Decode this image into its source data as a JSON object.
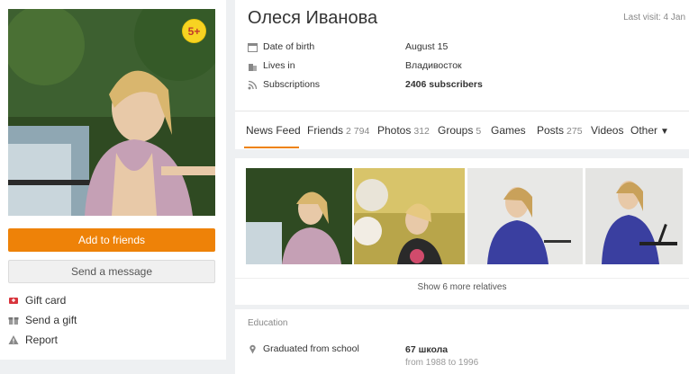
{
  "profile": {
    "name": "Олеся Иванова",
    "last_visit": "Last visit: 4 Jan",
    "age_badge": "5+"
  },
  "actions": {
    "add_friends": "Add to friends",
    "send_message": "Send a message",
    "gift_card": "Gift card",
    "send_gift": "Send a gift",
    "report": "Report"
  },
  "info": [
    {
      "label": "Date of birth",
      "value": "August 15",
      "icon": "calendar-icon"
    },
    {
      "label": "Lives in",
      "value": "Владивосток",
      "icon": "building-icon"
    },
    {
      "label": "Subscriptions",
      "value": "2406 subscribers",
      "icon": "rss-icon"
    }
  ],
  "tabs": [
    {
      "label": "News Feed",
      "count": ""
    },
    {
      "label": "Friends",
      "count": "2 794"
    },
    {
      "label": "Photos",
      "count": "312"
    },
    {
      "label": "Groups",
      "count": "5"
    },
    {
      "label": "Games",
      "count": ""
    },
    {
      "label": "Posts",
      "count": "275"
    },
    {
      "label": "Videos",
      "count": ""
    },
    {
      "label": "Other",
      "count": ""
    }
  ],
  "relatives": {
    "show_more": "Show 6 more relatives"
  },
  "education": {
    "title": "Education",
    "label": "Graduated from school",
    "school": "67 школа",
    "years": "from 1988 to 1996"
  },
  "colors": {
    "accent": "#ee8208",
    "badge": "#f7d322"
  }
}
